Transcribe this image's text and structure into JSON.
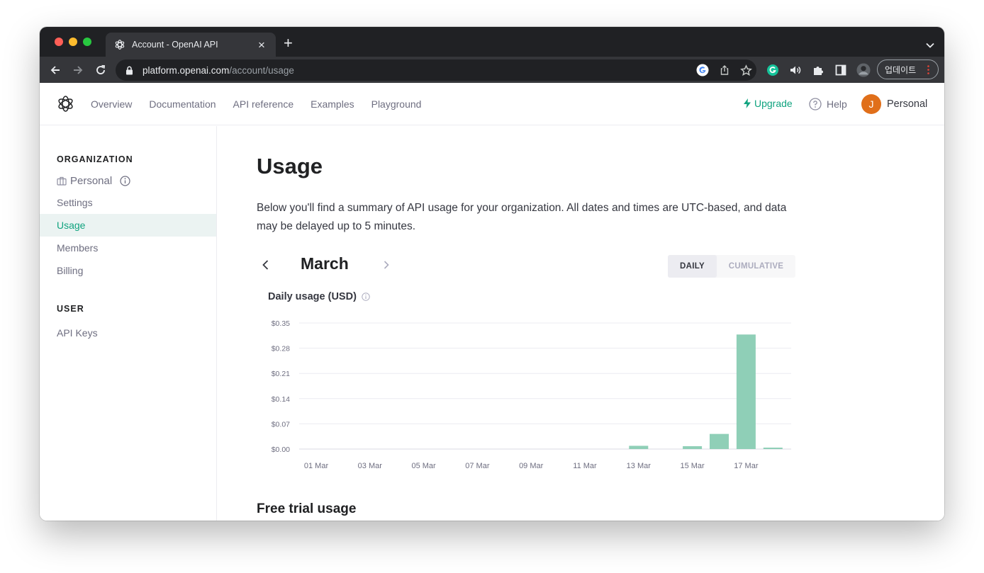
{
  "browser": {
    "tab_title": "Account - OpenAI API",
    "url_host": "platform.openai.com",
    "url_path": "/account/usage",
    "update_label": "업데이트",
    "accent_green": "#10a37f"
  },
  "topnav": {
    "links": [
      "Overview",
      "Documentation",
      "API reference",
      "Examples",
      "Playground"
    ],
    "upgrade": "Upgrade",
    "help": "Help",
    "avatar_initial": "J",
    "user_name": "Personal"
  },
  "sidebar": {
    "org_heading": "ORGANIZATION",
    "org_name": "Personal",
    "org_items": [
      "Settings",
      "Usage",
      "Members",
      "Billing"
    ],
    "active_item": "Usage",
    "user_heading": "USER",
    "user_items": [
      "API Keys"
    ]
  },
  "main": {
    "title": "Usage",
    "description": "Below you'll find a summary of API usage for your organization. All dates and times are UTC-based, and data may be delayed up to 5 minutes.",
    "month": "March",
    "toggle": {
      "daily": "DAILY",
      "cumulative": "CUMULATIVE",
      "selected": "DAILY"
    },
    "chart_title": "Daily usage (USD)",
    "section2_title": "Free trial usage"
  },
  "chart_data": {
    "type": "bar",
    "title": "Daily usage (USD)",
    "xlabel": "",
    "ylabel": "",
    "ylim": [
      0,
      0.35
    ],
    "yticks": [
      "$0.35",
      "$0.28",
      "$0.21",
      "$0.14",
      "$0.07",
      "$0.00"
    ],
    "ytick_values": [
      0.35,
      0.28,
      0.21,
      0.14,
      0.07,
      0
    ],
    "xtick_labels": [
      "01 Mar",
      "03 Mar",
      "05 Mar",
      "07 Mar",
      "09 Mar",
      "11 Mar",
      "13 Mar",
      "15 Mar",
      "17 Mar"
    ],
    "categories": [
      "01 Mar",
      "02 Mar",
      "03 Mar",
      "04 Mar",
      "05 Mar",
      "06 Mar",
      "07 Mar",
      "08 Mar",
      "09 Mar",
      "10 Mar",
      "11 Mar",
      "12 Mar",
      "13 Mar",
      "14 Mar",
      "15 Mar",
      "16 Mar",
      "17 Mar",
      "18 Mar"
    ],
    "values": [
      0,
      0,
      0,
      0,
      0,
      0,
      0,
      0,
      0,
      0,
      0,
      0,
      0.009,
      0,
      0.008,
      0.042,
      0.318,
      0.004
    ],
    "bar_color": "#8fcfb7",
    "grid": true
  }
}
